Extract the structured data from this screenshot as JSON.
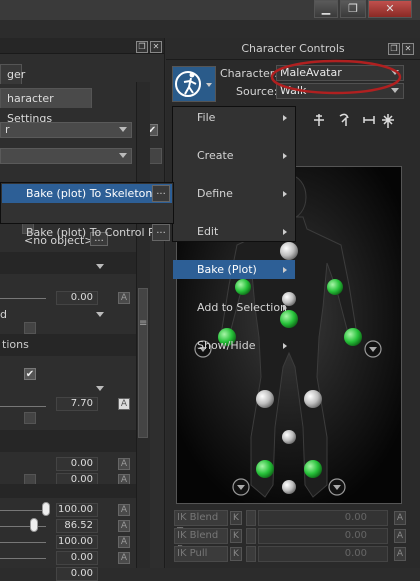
{
  "window": {
    "minimize_glyph": "▁",
    "restore_glyph": "❐",
    "close_glyph": "✕"
  },
  "left_panel": {
    "tab1": "ger",
    "tab2": "haracter Settings",
    "dropdown1_value": "r",
    "checkbox1": "✔",
    "no_object": "<no object>",
    "dots": "...",
    "value_a": "0.00",
    "dropdown_d": "d",
    "section_options": "tions",
    "checkbox2": "✔",
    "value_b": "7.70",
    "value_c": "0.00",
    "value_d": "0.00",
    "slider_values": [
      "100.00",
      "86.52",
      "100.00",
      "0.00",
      "0.00"
    ],
    "a_label": "A"
  },
  "right_panel": {
    "title": "Character Controls",
    "character_label": "Character:",
    "character_value": "MaleAvatar",
    "source_label": "Source:",
    "source_value": "Walk",
    "ik_rows": [
      {
        "name": "IK Blend T",
        "k": "K",
        "value": "0.00"
      },
      {
        "name": "IK Blend R",
        "k": "K",
        "value": "0.00"
      },
      {
        "name": "IK Pull",
        "k": "K",
        "value": "0.00"
      }
    ],
    "highlight_color": "#b02020"
  },
  "menu": {
    "items": [
      {
        "label": "File",
        "submenu": true
      },
      {
        "label": "Create",
        "submenu": true
      },
      {
        "label": "Define",
        "submenu": true
      },
      {
        "label": "Edit",
        "submenu": true
      },
      {
        "label": "Bake (Plot)",
        "submenu": true,
        "highlighted": true
      },
      {
        "label": "Add to Selection",
        "submenu": true
      },
      {
        "label": "Show/Hide",
        "submenu": true
      }
    ]
  },
  "submenu": {
    "items": [
      {
        "label": "Bake (plot) To Skeleton",
        "dots": "...",
        "highlighted": true
      },
      {
        "label": "Bake (plot) To Control Rig",
        "dots": "..."
      }
    ]
  },
  "colors": {
    "menu_highlight": "#2d5f96",
    "effector_green": "#27c23a",
    "effector_grey": "#bdbdbd"
  }
}
